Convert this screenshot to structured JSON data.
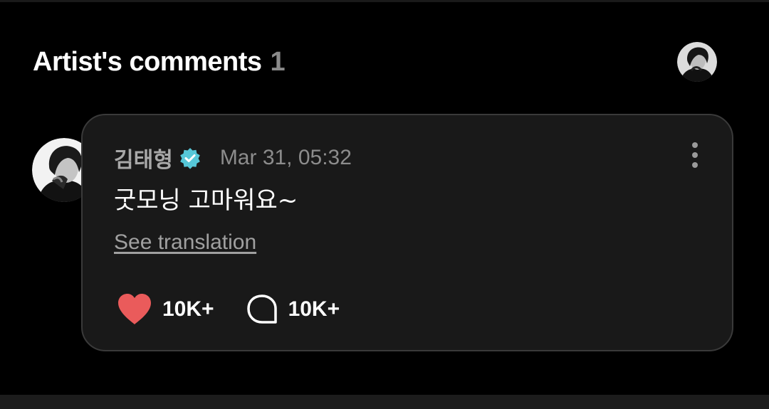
{
  "section": {
    "title": "Artist's comments",
    "count": "1"
  },
  "comment": {
    "author": "김태형",
    "verified": true,
    "timestamp": "Mar 31, 05:32",
    "text": "굿모닝 고마워요~",
    "translation_link": "See translation",
    "likes": "10K+",
    "replies": "10K+"
  },
  "icons": {
    "verified": "verified-badge-icon",
    "more": "more-vertical-icon",
    "like": "heart-icon",
    "reply": "speech-bubble-icon"
  },
  "colors": {
    "background": "#000000",
    "card": "#191919",
    "card_border": "#3a3a3a",
    "heart": "#ea5b5b",
    "verified": "#56c7d8",
    "muted_text": "#8c8c8c"
  }
}
